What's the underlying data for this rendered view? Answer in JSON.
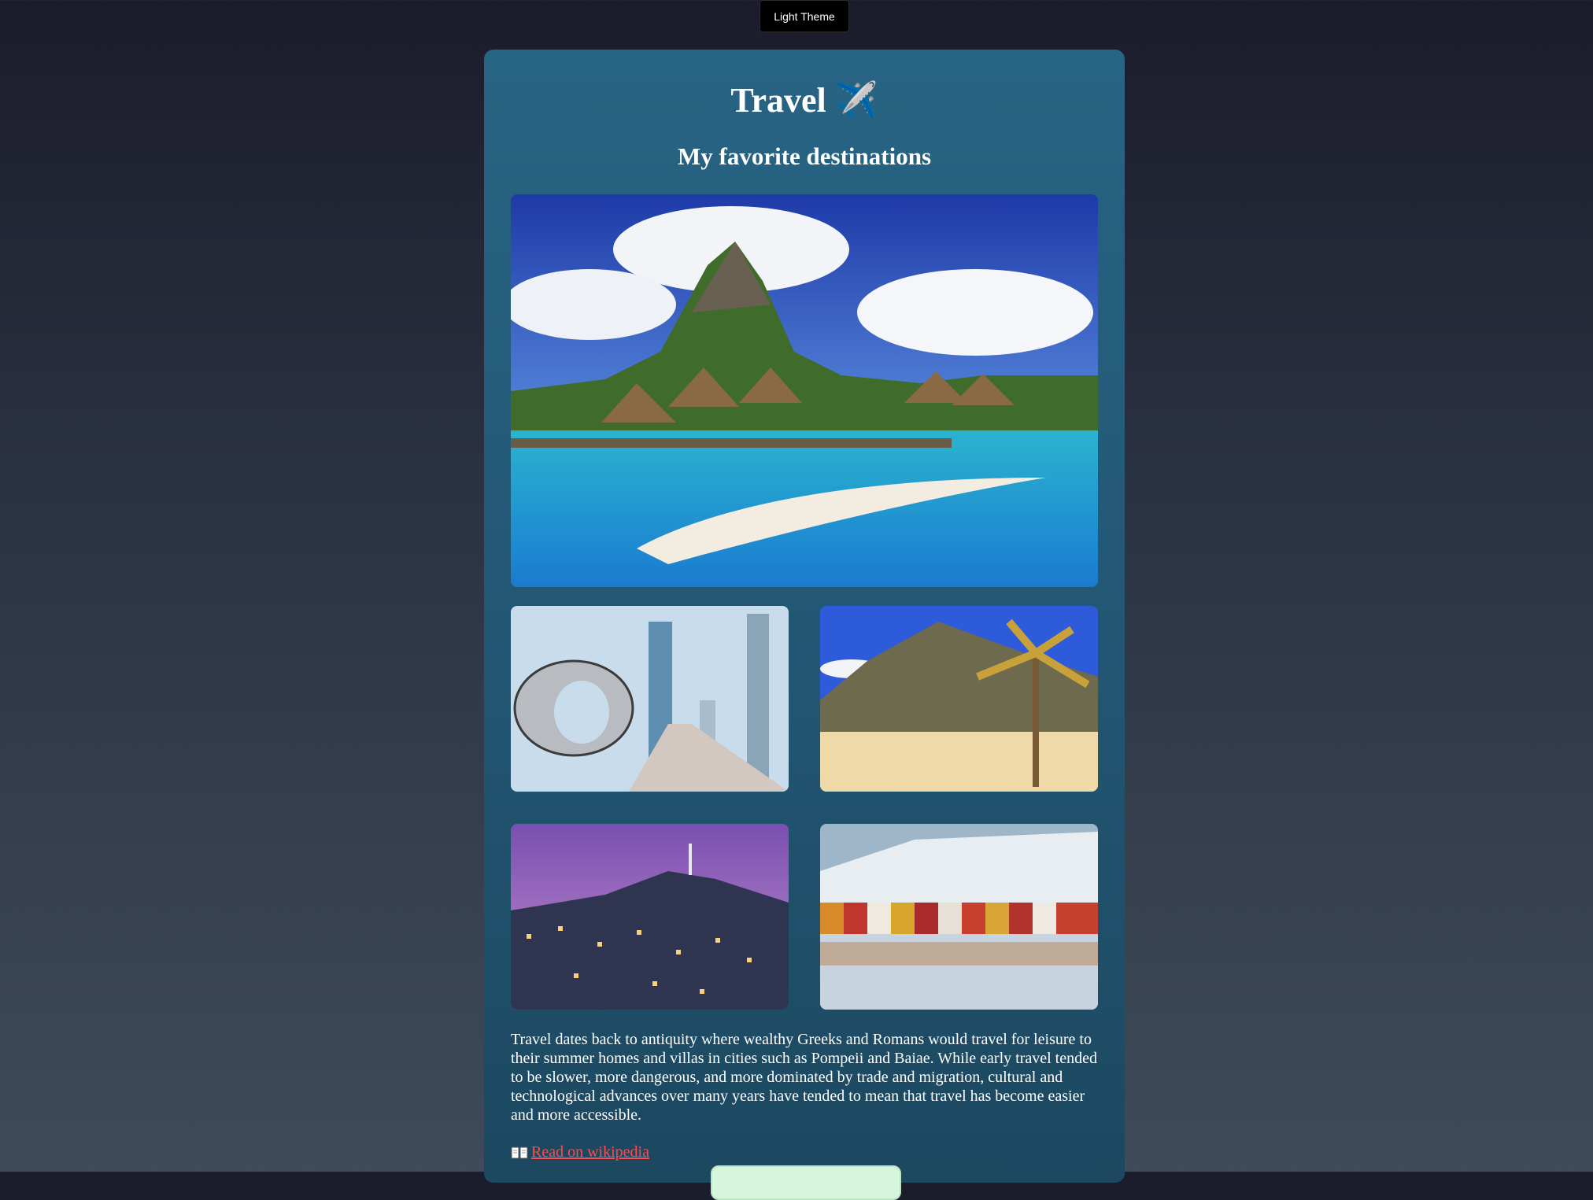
{
  "theme_toggle": {
    "label": "Light Theme"
  },
  "card": {
    "title": "Travel",
    "title_emoji": "✈️",
    "subtitle": "My favorite destinations",
    "description": "Travel dates back to antiquity where wealthy Greeks and Romans would travel for leisure to their summer homes and villas in cities such as Pompeii and Baiae. While early travel tended to be slower, more dangerous, and more dominated by trade and migration, cultural and technological advances over many years have tended to mean that travel has become easier and more accessible.",
    "link": {
      "icon": "book-icon",
      "label": "Read on wikipedia"
    }
  },
  "colors": {
    "card_top": "#286484",
    "card_bottom": "#1c4860",
    "link": "#ff4c4c",
    "page_bg_top": "#1b1c2b"
  }
}
